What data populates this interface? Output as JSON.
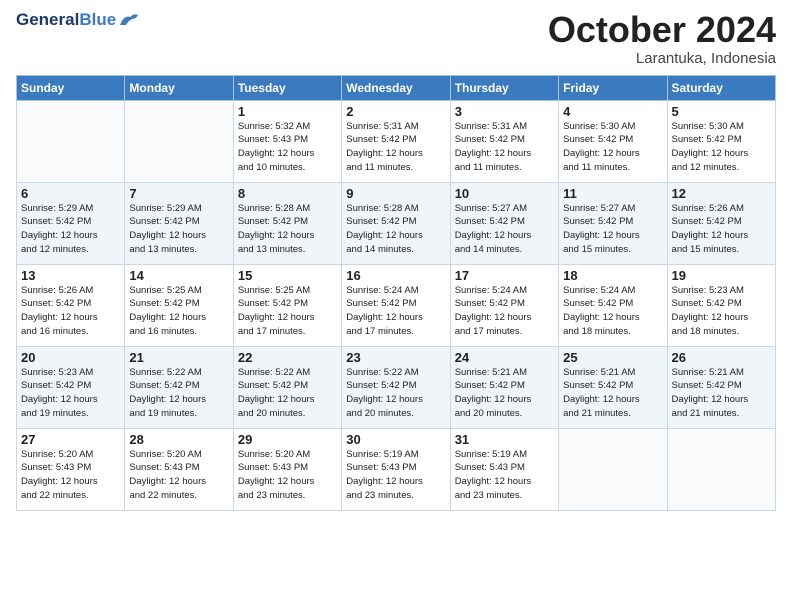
{
  "header": {
    "logo_general": "General",
    "logo_blue": "Blue",
    "month_title": "October 2024",
    "location": "Larantuka, Indonesia"
  },
  "days_of_week": [
    "Sunday",
    "Monday",
    "Tuesday",
    "Wednesday",
    "Thursday",
    "Friday",
    "Saturday"
  ],
  "weeks": [
    [
      {
        "day": "",
        "info": ""
      },
      {
        "day": "",
        "info": ""
      },
      {
        "day": "1",
        "info": "Sunrise: 5:32 AM\nSunset: 5:43 PM\nDaylight: 12 hours\nand 10 minutes."
      },
      {
        "day": "2",
        "info": "Sunrise: 5:31 AM\nSunset: 5:42 PM\nDaylight: 12 hours\nand 11 minutes."
      },
      {
        "day": "3",
        "info": "Sunrise: 5:31 AM\nSunset: 5:42 PM\nDaylight: 12 hours\nand 11 minutes."
      },
      {
        "day": "4",
        "info": "Sunrise: 5:30 AM\nSunset: 5:42 PM\nDaylight: 12 hours\nand 11 minutes."
      },
      {
        "day": "5",
        "info": "Sunrise: 5:30 AM\nSunset: 5:42 PM\nDaylight: 12 hours\nand 12 minutes."
      }
    ],
    [
      {
        "day": "6",
        "info": "Sunrise: 5:29 AM\nSunset: 5:42 PM\nDaylight: 12 hours\nand 12 minutes."
      },
      {
        "day": "7",
        "info": "Sunrise: 5:29 AM\nSunset: 5:42 PM\nDaylight: 12 hours\nand 13 minutes."
      },
      {
        "day": "8",
        "info": "Sunrise: 5:28 AM\nSunset: 5:42 PM\nDaylight: 12 hours\nand 13 minutes."
      },
      {
        "day": "9",
        "info": "Sunrise: 5:28 AM\nSunset: 5:42 PM\nDaylight: 12 hours\nand 14 minutes."
      },
      {
        "day": "10",
        "info": "Sunrise: 5:27 AM\nSunset: 5:42 PM\nDaylight: 12 hours\nand 14 minutes."
      },
      {
        "day": "11",
        "info": "Sunrise: 5:27 AM\nSunset: 5:42 PM\nDaylight: 12 hours\nand 15 minutes."
      },
      {
        "day": "12",
        "info": "Sunrise: 5:26 AM\nSunset: 5:42 PM\nDaylight: 12 hours\nand 15 minutes."
      }
    ],
    [
      {
        "day": "13",
        "info": "Sunrise: 5:26 AM\nSunset: 5:42 PM\nDaylight: 12 hours\nand 16 minutes."
      },
      {
        "day": "14",
        "info": "Sunrise: 5:25 AM\nSunset: 5:42 PM\nDaylight: 12 hours\nand 16 minutes."
      },
      {
        "day": "15",
        "info": "Sunrise: 5:25 AM\nSunset: 5:42 PM\nDaylight: 12 hours\nand 17 minutes."
      },
      {
        "day": "16",
        "info": "Sunrise: 5:24 AM\nSunset: 5:42 PM\nDaylight: 12 hours\nand 17 minutes."
      },
      {
        "day": "17",
        "info": "Sunrise: 5:24 AM\nSunset: 5:42 PM\nDaylight: 12 hours\nand 17 minutes."
      },
      {
        "day": "18",
        "info": "Sunrise: 5:24 AM\nSunset: 5:42 PM\nDaylight: 12 hours\nand 18 minutes."
      },
      {
        "day": "19",
        "info": "Sunrise: 5:23 AM\nSunset: 5:42 PM\nDaylight: 12 hours\nand 18 minutes."
      }
    ],
    [
      {
        "day": "20",
        "info": "Sunrise: 5:23 AM\nSunset: 5:42 PM\nDaylight: 12 hours\nand 19 minutes."
      },
      {
        "day": "21",
        "info": "Sunrise: 5:22 AM\nSunset: 5:42 PM\nDaylight: 12 hours\nand 19 minutes."
      },
      {
        "day": "22",
        "info": "Sunrise: 5:22 AM\nSunset: 5:42 PM\nDaylight: 12 hours\nand 20 minutes."
      },
      {
        "day": "23",
        "info": "Sunrise: 5:22 AM\nSunset: 5:42 PM\nDaylight: 12 hours\nand 20 minutes."
      },
      {
        "day": "24",
        "info": "Sunrise: 5:21 AM\nSunset: 5:42 PM\nDaylight: 12 hours\nand 20 minutes."
      },
      {
        "day": "25",
        "info": "Sunrise: 5:21 AM\nSunset: 5:42 PM\nDaylight: 12 hours\nand 21 minutes."
      },
      {
        "day": "26",
        "info": "Sunrise: 5:21 AM\nSunset: 5:42 PM\nDaylight: 12 hours\nand 21 minutes."
      }
    ],
    [
      {
        "day": "27",
        "info": "Sunrise: 5:20 AM\nSunset: 5:43 PM\nDaylight: 12 hours\nand 22 minutes."
      },
      {
        "day": "28",
        "info": "Sunrise: 5:20 AM\nSunset: 5:43 PM\nDaylight: 12 hours\nand 22 minutes."
      },
      {
        "day": "29",
        "info": "Sunrise: 5:20 AM\nSunset: 5:43 PM\nDaylight: 12 hours\nand 23 minutes."
      },
      {
        "day": "30",
        "info": "Sunrise: 5:19 AM\nSunset: 5:43 PM\nDaylight: 12 hours\nand 23 minutes."
      },
      {
        "day": "31",
        "info": "Sunrise: 5:19 AM\nSunset: 5:43 PM\nDaylight: 12 hours\nand 23 minutes."
      },
      {
        "day": "",
        "info": ""
      },
      {
        "day": "",
        "info": ""
      }
    ]
  ]
}
